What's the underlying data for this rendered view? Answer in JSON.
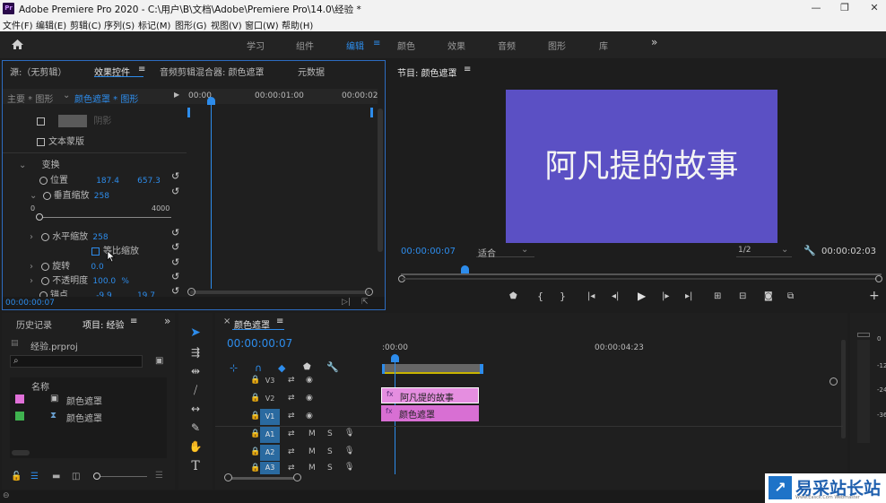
{
  "window": {
    "app_icon": "Pr",
    "title": "Adobe Premiere Pro 2020 - C:\\用户\\B\\文档\\Adobe\\Premiere Pro\\14.0\\经验 *",
    "min": "—",
    "max": "❐",
    "close": "✕"
  },
  "menu": [
    "文件(F)",
    "编辑(E)",
    "剪辑(C)",
    "序列(S)",
    "标记(M)",
    "图形(G)",
    "视图(V)",
    "窗口(W)",
    "帮助(H)"
  ],
  "workspaces": {
    "items": [
      "学习",
      "组件",
      "编辑",
      "颜色",
      "效果",
      "音频",
      "图形",
      "库"
    ],
    "active": "编辑",
    "menu_icon": "≡",
    "more": "»"
  },
  "effect_panel": {
    "tabs": [
      "源:（无剪辑）",
      "效果控件",
      "音频剪辑混合器: 颜色遮罩",
      "元数据"
    ],
    "tab_menu": "≡",
    "master": "主要 * 图形",
    "clip": "颜色遮罩 * 图形",
    "ruler": [
      "00:00",
      "00:00:01:00",
      "00:00:02"
    ],
    "shadow": "阴影",
    "text_mask": "文本蒙版",
    "transform": "变换",
    "position": {
      "label": "位置",
      "x": "187.4",
      "y": "657.3"
    },
    "vscale": {
      "label": "垂直缩放",
      "value": "258"
    },
    "slider": {
      "min": "0",
      "max": "4000"
    },
    "hscale": {
      "label": "水平缩放",
      "value": "258"
    },
    "uniform": "等比缩放",
    "rotation": {
      "label": "旋转",
      "value": "0.0"
    },
    "opacity": {
      "label": "不透明度",
      "value": "100.0",
      "unit": "%"
    },
    "anchor": {
      "label": "锚点",
      "x": "-9.9",
      "y": "19.7"
    },
    "timecode": "00:00:00:07"
  },
  "program": {
    "title": "节目: 颜色遮罩",
    "menu": "≡",
    "video_text": "阿凡提的故事",
    "timecode": "00:00:00:07",
    "fit": "适合",
    "resolution": "1/2",
    "duration": "00:00:02:03",
    "add": "+"
  },
  "project": {
    "tabs": [
      "历史记录",
      "项目: 经验"
    ],
    "menu": "≡",
    "more": "»",
    "file": "经验.prproj",
    "col_name": "名称",
    "items": [
      {
        "name": "颜色遮罩",
        "color": "#e070d8"
      },
      {
        "name": "颜色遮罩",
        "color": "#3fb24f"
      }
    ]
  },
  "timeline": {
    "title": "颜色遮罩",
    "menu": "≡",
    "close": "×",
    "timecode": "00:00:00:07",
    "ruler": [
      ":00:00",
      "00:00:04:23"
    ],
    "video_tracks": [
      "V3",
      "V2",
      "V1"
    ],
    "audio_tracks": [
      "A1",
      "A2",
      "A3"
    ],
    "clip_v2": "阿凡提的故事",
    "clip_v1": "颜色遮罩",
    "m": "M",
    "s": "S",
    "meter_labels": [
      "0",
      "-12",
      "-24",
      "-36"
    ]
  },
  "watermark": {
    "icon": "↗",
    "text": "易采站长站",
    "url": "Www.Easck.Com Webmaster"
  }
}
